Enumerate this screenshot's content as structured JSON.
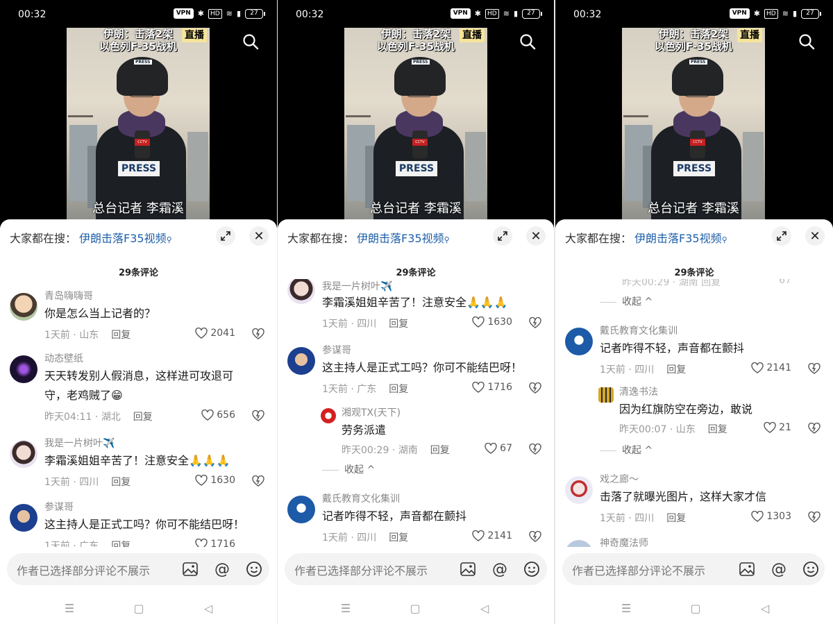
{
  "status_bar": {
    "time": "00:32",
    "vpn": "VPN",
    "hd": "HD",
    "battery": "27"
  },
  "video": {
    "headline_line1": "伊朗：击落2架",
    "headline_line2": "以色列F-35战机",
    "live_badge": "直播",
    "caption": "总台记者 李霜溪",
    "helmet_text": "PRESS",
    "vest_text": "PRESS",
    "mic_logo": "CCTV"
  },
  "sheet": {
    "hot_search_label": "大家都在搜：",
    "hot_search_link": "伊朗击落F35视频",
    "comment_count": "29条评论",
    "close": "✕"
  },
  "input": {
    "placeholder": "作者已选择部分评论不展示"
  },
  "comments": {
    "c1": {
      "name": "青岛嗨嗨哥",
      "text": "你是怎么当上记者的？",
      "time": "1天前 · 山东",
      "reply": "回复",
      "likes": "2041"
    },
    "c2": {
      "name": "动态壁纸",
      "text": "天天转发别人假消息，这样进可攻退可守，老鸡贼了😁",
      "time": "昨天04:11 · 湖北",
      "reply": "回复",
      "likes": "656"
    },
    "c3": {
      "name": "我是一片树叶✈️",
      "text": "李霜溪姐姐辛苦了！注意安全🙏🙏🙏",
      "time": "1天前 · 四川",
      "reply": "回复",
      "likes": "1630"
    },
    "c4": {
      "name": "参谋哥",
      "text": "这主持人是正式工吗？你可不能结巴呀！",
      "time": "1天前 · 广东",
      "reply": "回复",
      "likes": "1716"
    },
    "c5": {
      "name": "湘观TX(天下)",
      "text": "劳务派遣",
      "time": "昨天00:29 · 湖南",
      "reply": "回复",
      "likes": "67"
    },
    "c6": {
      "name": "戴氏教育文化集训",
      "text": "记者咋得不轻，声音都在颤抖",
      "time": "1天前 · 四川",
      "reply": "回复",
      "likes": "2141"
    },
    "c7": {
      "name": "清逸书法",
      "text": "因为红旗防空在旁边，敢说",
      "time": "昨天00:07 · 山东",
      "reply": "回复",
      "likes": "21"
    },
    "c8": {
      "name": "戏之廊～",
      "text": "击落了就曝光图片，这样大家才信",
      "time": "1天前 · 四川",
      "reply": "回复",
      "likes": "1303"
    },
    "c9": {
      "name": "神奇魔法师"
    }
  },
  "collapse_label": "收起 ^",
  "partial_meta_top": "昨天00:29 · 湖南   回复",
  "partial_likes_top": "67",
  "colors": {
    "link": "#1e5fa8",
    "background": "#ffffff",
    "video_bg": "#000000"
  },
  "icons": [
    "search-icon",
    "expand-icon",
    "close-icon",
    "heart-icon",
    "dislike-icon",
    "image-icon",
    "at-icon",
    "emoji-icon",
    "menu-icon",
    "home-icon",
    "back-icon"
  ]
}
